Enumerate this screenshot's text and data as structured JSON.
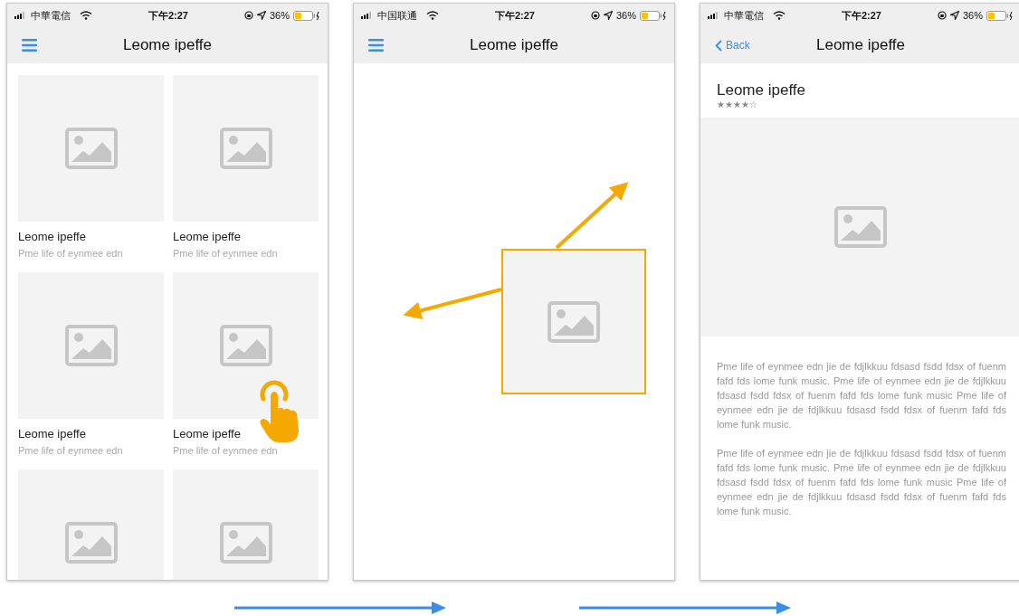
{
  "screens": [
    {
      "status_bar": {
        "carrier": "中華電信",
        "time": "下午2:27",
        "battery": "36%"
      },
      "nav": {
        "left": {
          "kind": "menu"
        },
        "title": "Leome ipeffe"
      },
      "content": {
        "kind": "grid",
        "cards": [
          {
            "title": "Leome ipeffe",
            "subtitle": "Pme life of eynmee edn",
            "tapped": false
          },
          {
            "title": "Leome ipeffe",
            "subtitle": "Pme life of eynmee edn",
            "tapped": false
          },
          {
            "title": "Leome ipeffe",
            "subtitle": "Pme life of eynmee edn",
            "tapped": false
          },
          {
            "title": "Leome ipeffe",
            "subtitle": "Pme life of eynmee edn",
            "tapped": true
          },
          {
            "tapped": false
          },
          {
            "tapped": false
          }
        ]
      }
    },
    {
      "status_bar": {
        "carrier": "中国联通",
        "time": "下午2:27",
        "battery": "36%"
      },
      "nav": {
        "left": {
          "kind": "menu"
        },
        "title": "Leome ipeffe"
      },
      "content": {
        "kind": "gesture"
      }
    },
    {
      "status_bar": {
        "carrier": "中華電信",
        "time": "下午2:27",
        "battery": "36%"
      },
      "nav": {
        "left": {
          "kind": "back",
          "label": "Back"
        },
        "title": "Leome ipeffe"
      },
      "content": {
        "kind": "detail",
        "heading": "Leome ipeffe",
        "stars": 4,
        "paragraphs": [
          "Pme life of eynmee edn jie de fdjlkkuu fdsasd fsdd fdsx of fuenm fafd fds lome funk music. Pme life of eynmee edn jie de fdjlkkuu fdsasd fsdd fdsx of fuenm fafd fds lome funk music Pme life of eynmee edn jie de fdjlkkuu fdsasd fsdd fdsx of fuenm fafd fds lome funk music.",
          "Pme life of eynmee edn jie de fdjlkkuu fdsasd fsdd fdsx of fuenm fafd fds lome funk music. Pme life of eynmee edn jie de fdjlkkuu fdsasd fsdd fdsx of fuenm fafd fds lome funk music Pme life of eynmee edn jie de fdjlkkuu fdsasd fsdd fdsx of fuenm fafd fds lome funk music."
        ]
      }
    }
  ]
}
